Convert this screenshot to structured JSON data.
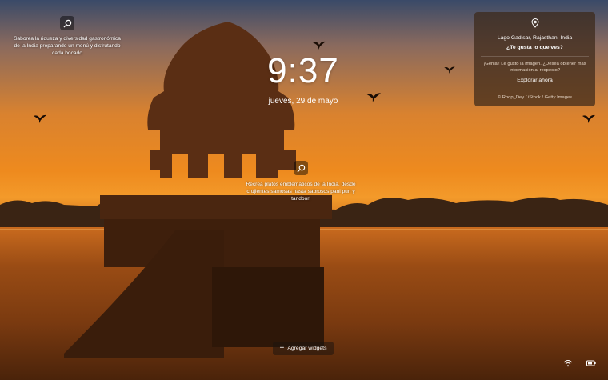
{
  "lockscreen": {
    "time": "9:37",
    "date": "jueves, 29 de mayo"
  },
  "hotspots": [
    {
      "text": "Saborea la riqueza y diversidad gastronómica de la India preparando un menú y disfrutando cada bocado",
      "icon": "search-icon"
    },
    {
      "text": "Recrea platos emblemáticos de la India, desde crujientes samosas hasta sabrosos pani puri y tandoori",
      "icon": "search-icon"
    }
  ],
  "spotlight_card": {
    "icon": "location-pin-icon",
    "location": "Lago Gadisar, Rajasthan, India",
    "question": "¿Te gusta lo que ves?",
    "description": "¡Genial! Le gustó la imagen. ¿Desea obtener más información al respecto?",
    "explore_label": "Explorar ahora",
    "credit": "© Roop_Dey / iStock / Getty Images"
  },
  "widgets_button": {
    "icon": "plus-icon",
    "label": "Agregar widgets"
  },
  "tray": {
    "icons": [
      "wifi-icon",
      "battery-icon"
    ]
  },
  "colors": {
    "card_bg": "#3c2819",
    "sky_orange": "#ee8a1e",
    "water_dark": "#4a230a"
  }
}
